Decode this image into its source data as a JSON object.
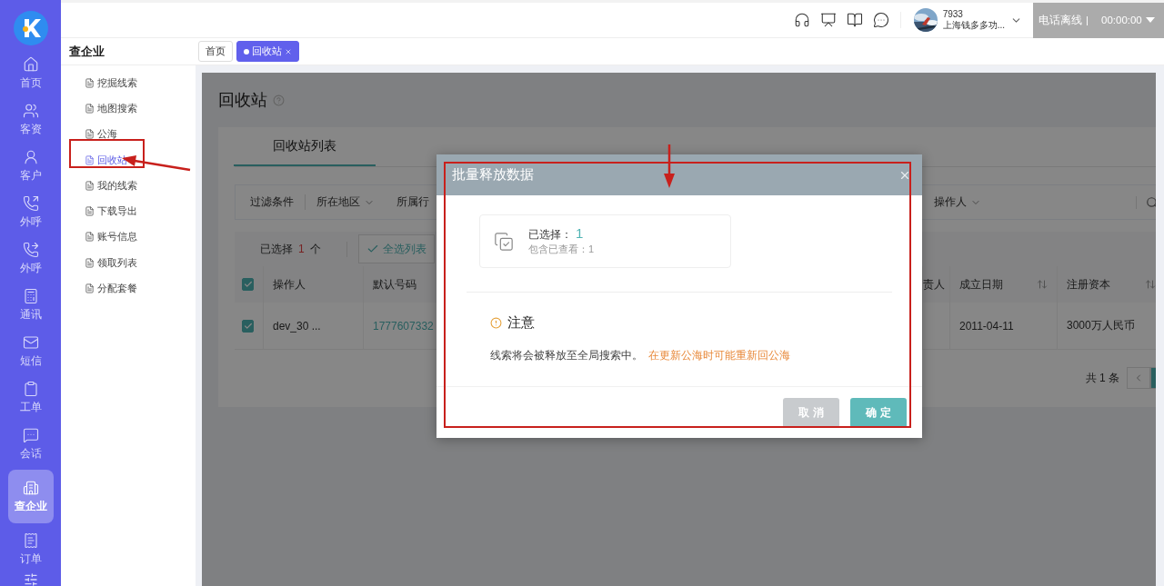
{
  "rail": {
    "items": [
      {
        "label": "首页",
        "selected": false
      },
      {
        "label": "客资",
        "selected": false
      },
      {
        "label": "客户",
        "selected": false
      },
      {
        "label": "外呼",
        "selected": false
      },
      {
        "label": "外呼",
        "selected": false
      },
      {
        "label": "通讯",
        "selected": false
      },
      {
        "label": "短信",
        "selected": false
      },
      {
        "label": "工单",
        "selected": false
      },
      {
        "label": "会话",
        "selected": false
      },
      {
        "label": "查企业",
        "selected": true
      },
      {
        "label": "订单",
        "selected": false
      }
    ]
  },
  "header": {
    "user": {
      "id": "7933",
      "company": "上海钱多多功..."
    },
    "phone_status": {
      "label": "电话离线",
      "separator": "|",
      "timer": "00:00:00"
    }
  },
  "section_title": "查企业",
  "tabs": [
    {
      "label": "首页",
      "selected": false,
      "closable": false
    },
    {
      "label": "回收站",
      "selected": true,
      "closable": true
    }
  ],
  "subnav": {
    "items": [
      {
        "label": "挖掘线索",
        "selected": false
      },
      {
        "label": "地图搜索",
        "selected": false
      },
      {
        "label": "公海",
        "selected": false
      },
      {
        "label": "回收站",
        "selected": true
      },
      {
        "label": "我的线索",
        "selected": false
      },
      {
        "label": "下载导出",
        "selected": false
      },
      {
        "label": "账号信息",
        "selected": false
      },
      {
        "label": "领取列表",
        "selected": false
      },
      {
        "label": "分配套餐",
        "selected": false
      }
    ]
  },
  "page": {
    "title": "回收站",
    "card_tabs": [
      {
        "label": "回收站列表",
        "selected": true
      }
    ],
    "filters": [
      {
        "label": "过滤条件",
        "kind": "heading"
      },
      {
        "label": "所在地区",
        "kind": "dropdown"
      },
      {
        "label": "所属行",
        "kind": "plain"
      },
      {
        "label": "操作人",
        "kind": "dropdown"
      }
    ],
    "selection": {
      "prefix": "已选择",
      "count": "1",
      "suffix": "个",
      "select_all": "全选列表"
    },
    "table": {
      "all_checked": true,
      "columns": [
        {
          "label": "操作人",
          "sortable": false
        },
        {
          "label": "默认号码"
        },
        {
          "label": "责人"
        },
        {
          "label": "成立日期",
          "sortable": true
        },
        {
          "label": "注册资本",
          "sortable": true
        }
      ],
      "rows": [
        {
          "checked": true,
          "operator": "dev_30 ...",
          "phone": "1777607332",
          "date": "2011-04-11",
          "capital": "3000万人民币"
        }
      ]
    },
    "pagination": {
      "total": "共 1 条"
    }
  },
  "modal": {
    "title": "批量释放数据",
    "selected_label": "已选择：",
    "selected_count": "1",
    "viewed": "包含已查看：1",
    "notice_title": "注意",
    "notice_text": "线索将会被释放至全局搜索中。",
    "notice_warning": "在更新公海时可能重新回公海",
    "buttons": [
      {
        "label": "取 消",
        "kind": "cancel"
      },
      {
        "label": "确 定",
        "kind": "primary"
      }
    ]
  }
}
